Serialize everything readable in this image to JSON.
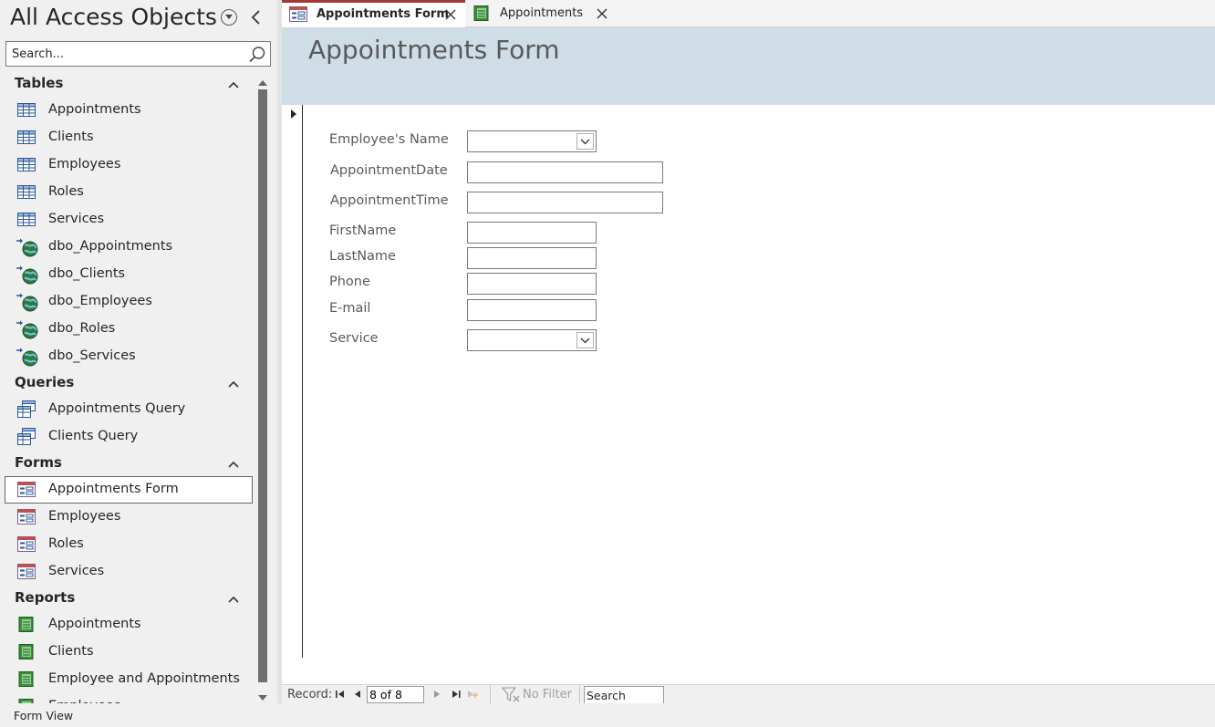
{
  "nav": {
    "title": "All Access Objects",
    "search_placeholder": "Search...",
    "groups": [
      {
        "label": "Tables",
        "items": [
          {
            "label": "Appointments",
            "icon": "table-icon"
          },
          {
            "label": "Clients",
            "icon": "table-icon"
          },
          {
            "label": "Employees",
            "icon": "table-icon"
          },
          {
            "label": "Roles",
            "icon": "table-icon"
          },
          {
            "label": "Services",
            "icon": "table-icon"
          },
          {
            "label": "dbo_Appointments",
            "icon": "linked-table-icon"
          },
          {
            "label": "dbo_Clients",
            "icon": "linked-table-icon"
          },
          {
            "label": "dbo_Employees",
            "icon": "linked-table-icon"
          },
          {
            "label": "dbo_Roles",
            "icon": "linked-table-icon"
          },
          {
            "label": "dbo_Services",
            "icon": "linked-table-icon"
          }
        ]
      },
      {
        "label": "Queries",
        "items": [
          {
            "label": "Appointments Query",
            "icon": "query-icon"
          },
          {
            "label": "Clients Query",
            "icon": "query-icon"
          }
        ]
      },
      {
        "label": "Forms",
        "items": [
          {
            "label": "Appointments Form",
            "icon": "form-icon"
          },
          {
            "label": "Employees",
            "icon": "form-icon"
          },
          {
            "label": "Roles",
            "icon": "form-icon"
          },
          {
            "label": "Services",
            "icon": "form-icon"
          }
        ]
      },
      {
        "label": "Reports",
        "items": [
          {
            "label": "Appointments",
            "icon": "report-icon"
          },
          {
            "label": "Clients",
            "icon": "report-icon"
          },
          {
            "label": "Employee and Appointments",
            "icon": "report-icon"
          },
          {
            "label": "Employees",
            "icon": "report-icon"
          }
        ]
      }
    ],
    "selected_item": "Appointments Form"
  },
  "tabs": [
    {
      "label": "Appointments Form",
      "icon": "form-icon",
      "active": true
    },
    {
      "label": "Appointments",
      "icon": "report-icon",
      "active": false
    }
  ],
  "form": {
    "title": "Appointments Form",
    "fields": {
      "employee_name": {
        "label": "Employee's Name",
        "value": ""
      },
      "appointment_date": {
        "label": "AppointmentDate",
        "value": ""
      },
      "appointment_time": {
        "label": "AppointmentTime",
        "value": ""
      },
      "first_name": {
        "label": "FirstName",
        "value": ""
      },
      "last_name": {
        "label": "LastName",
        "value": ""
      },
      "phone": {
        "label": "Phone",
        "value": ""
      },
      "email": {
        "label": "E-mail",
        "value": ""
      },
      "service": {
        "label": "Service",
        "value": ""
      }
    }
  },
  "record_nav": {
    "label": "Record:",
    "current": "8 of 8",
    "filter_label": "No Filter",
    "search_placeholder": "Search"
  },
  "status": {
    "text": "Form View"
  },
  "colors": {
    "accent": "#a4373a",
    "form_header_bg": "#cfdde7",
    "label_text": "#595959"
  }
}
